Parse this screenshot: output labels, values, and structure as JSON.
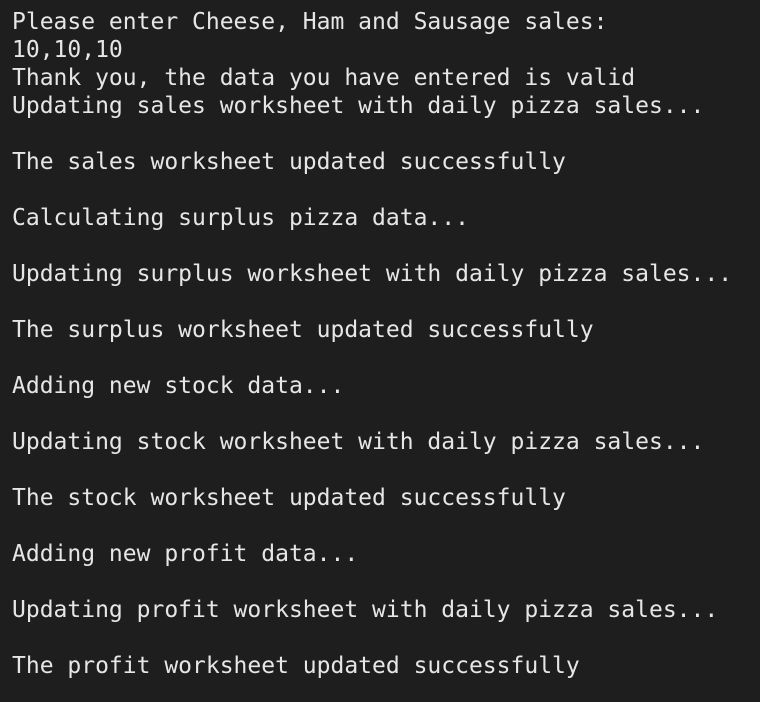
{
  "terminal": {
    "background": "#1e1e1e",
    "foreground": "#e6e6e6",
    "lines": [
      "Please enter Cheese, Ham and Sausage sales:",
      "10,10,10",
      "Thank you, the data you have entered is valid",
      "Updating sales worksheet with daily pizza sales...",
      "",
      "The sales worksheet updated successfully",
      "",
      "Calculating surplus pizza data...",
      "",
      "Updating surplus worksheet with daily pizza sales...",
      "",
      "The surplus worksheet updated successfully",
      "",
      "Adding new stock data...",
      "",
      "Updating stock worksheet with daily pizza sales...",
      "",
      "The stock worksheet updated successfully",
      "",
      "Adding new profit data...",
      "",
      "Updating profit worksheet with daily pizza sales...",
      "",
      "The profit worksheet updated successfully"
    ]
  }
}
